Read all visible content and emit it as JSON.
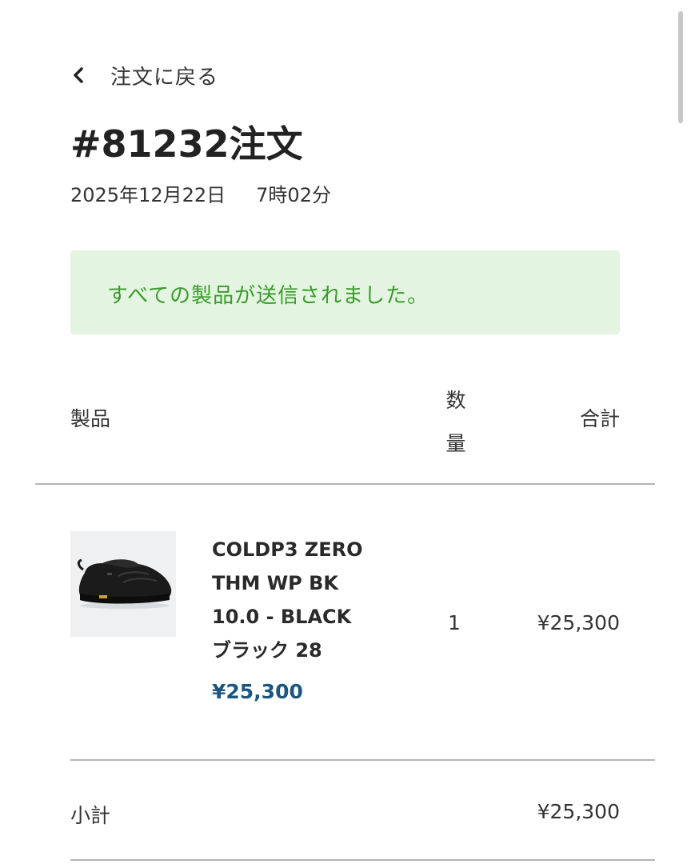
{
  "nav": {
    "back_label": "注文に戻る",
    "back_icon": "chevron-left-icon"
  },
  "order": {
    "title": "#81232注文",
    "date": "2025年12月22日",
    "time": "7時02分"
  },
  "notice": {
    "message": "すべての製品が送信されました。",
    "background": "#e3f5e1",
    "text_color": "#3b9a2c"
  },
  "table": {
    "headers": {
      "product": "製品",
      "quantity": "数量",
      "total": "合計"
    },
    "rows": [
      {
        "name": "COLDP3 ZERO\nTHM WP BK\n10.0 - BLACK\nブラック 28",
        "price": "¥25,300",
        "quantity": "1",
        "total": "¥25,300",
        "image": "black-sneaker-product-image"
      }
    ]
  },
  "subtotal": {
    "label": "小計",
    "value": "¥25,300"
  },
  "colors": {
    "price_accent": "#1c567f",
    "divider": "#b5b5b5"
  }
}
